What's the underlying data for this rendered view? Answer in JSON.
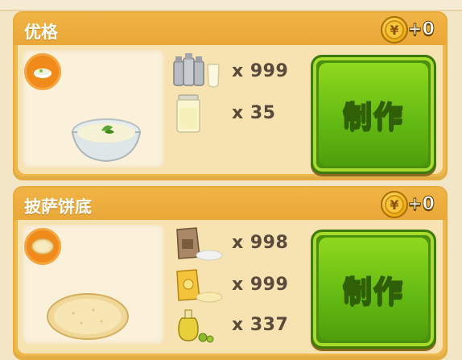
{
  "recipes": [
    {
      "title": "优格",
      "coin_symbol": "¥",
      "reward": "+0",
      "make_label": "制作",
      "ingredients": [
        {
          "icon": "milk-bottles-icon",
          "count": "x 999"
        },
        {
          "icon": "yogurt-jar-icon",
          "count": "x 35"
        }
      ]
    },
    {
      "title": "披萨饼底",
      "coin_symbol": "¥",
      "reward": "+0",
      "make_label": "制作",
      "ingredients": [
        {
          "icon": "flour-sack-icon",
          "count": "x 998"
        },
        {
          "icon": "cornmeal-bag-icon",
          "count": "x 999"
        },
        {
          "icon": "olive-oil-icon",
          "count": "x 337"
        }
      ]
    }
  ],
  "colors": {
    "panel": "#efb84c",
    "body": "#f7e3b2",
    "button_green": "#62b812",
    "badge_orange": "#f08a1a"
  }
}
